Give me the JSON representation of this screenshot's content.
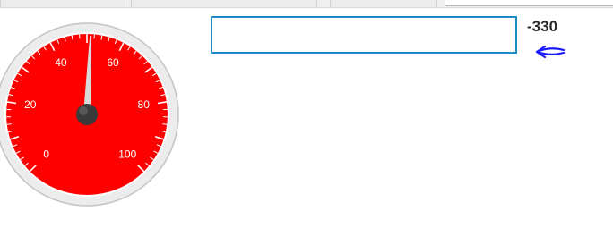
{
  "gauge": {
    "labels": [
      "0",
      "20",
      "40",
      "60",
      "80",
      "100"
    ],
    "needle_value": 51,
    "face_color": "#ff0000",
    "bezel_color": "#e6e6e6",
    "needle_color": "#d9d9d9",
    "hub_color": "#3a3a3a"
  },
  "text_field": {
    "value": ""
  },
  "readout": {
    "value": "-330"
  },
  "arrow": {
    "icon": "left-arrow-icon",
    "color": "#1a1aff"
  }
}
